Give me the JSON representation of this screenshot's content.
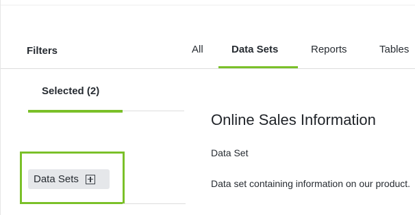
{
  "filters": {
    "title": "Filters",
    "selected_tab_label": "Selected (2)",
    "chip": {
      "label": "Data Sets",
      "icon": "plus-square-icon"
    }
  },
  "tabs": [
    {
      "label": "All",
      "active": false
    },
    {
      "label": "Data Sets",
      "active": true
    },
    {
      "label": "Reports",
      "active": false
    },
    {
      "label": "Tables",
      "active": false
    }
  ],
  "result": {
    "title": "Online Sales Information",
    "type": "Data Set",
    "description": "Data set containing information on our product."
  },
  "colors": {
    "accent": "#7ac028",
    "chip_bg": "#e5e7ea",
    "text": "#262b31",
    "rule": "#dcdcdc"
  }
}
